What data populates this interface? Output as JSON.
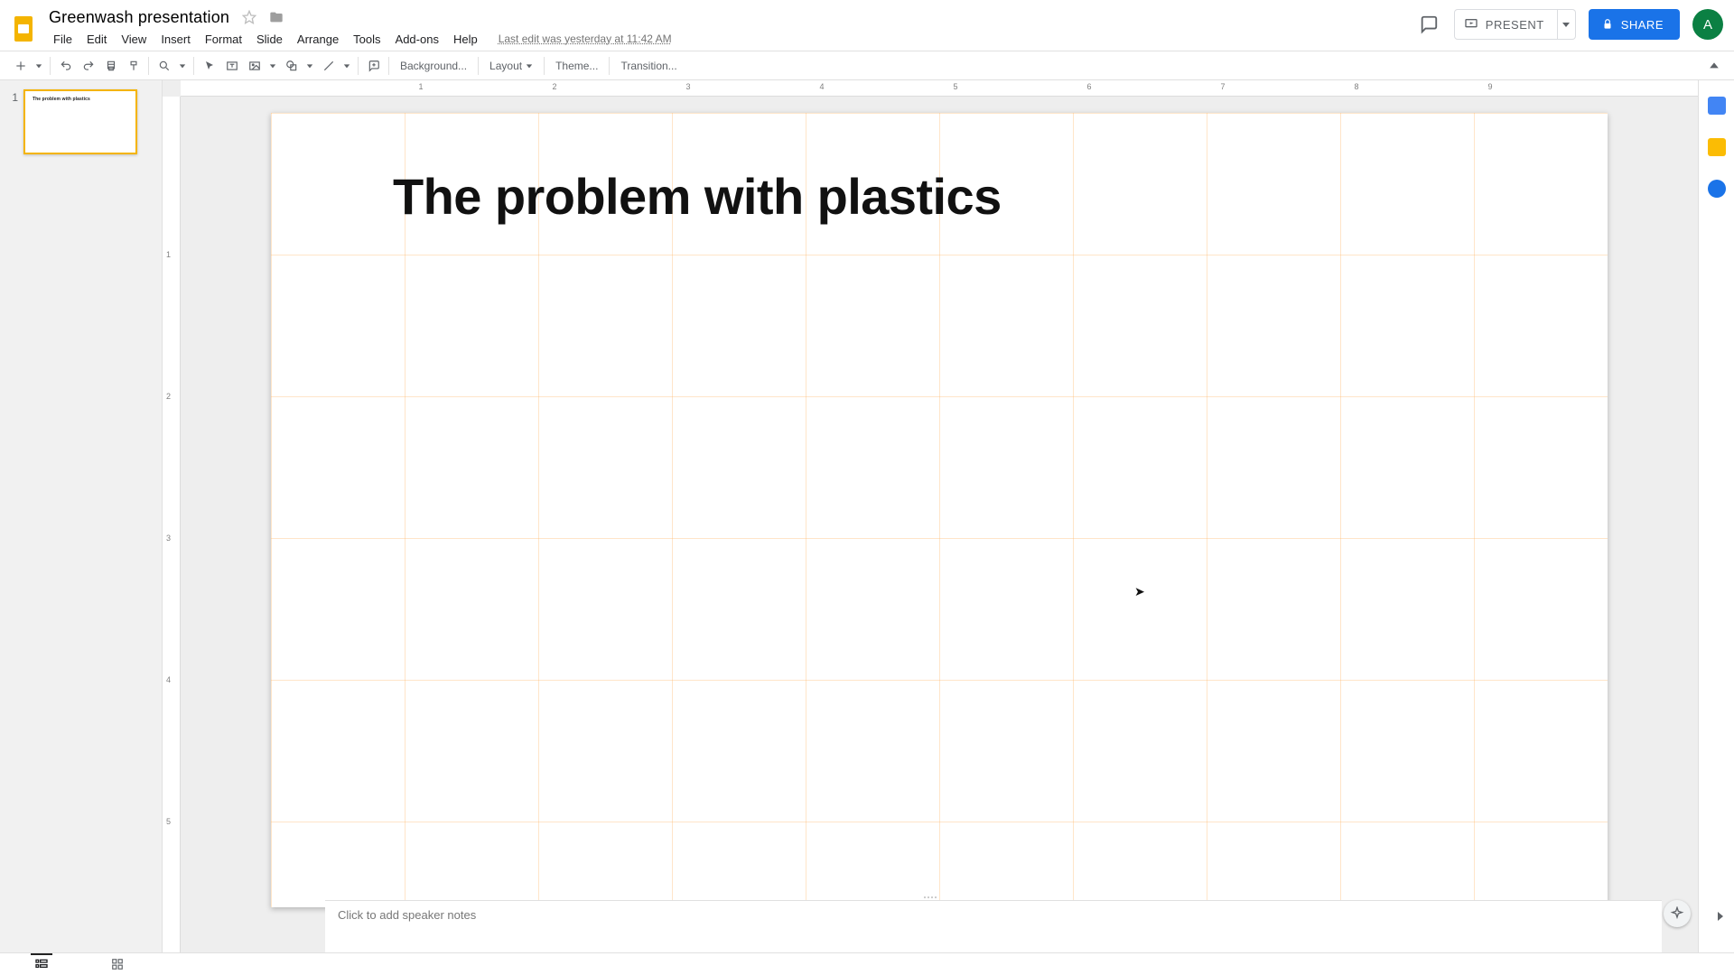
{
  "doc": {
    "title": "Greenwash presentation"
  },
  "menus": {
    "file": "File",
    "edit": "Edit",
    "view": "View",
    "insert": "Insert",
    "format": "Format",
    "slide": "Slide",
    "arrange": "Arrange",
    "tools": "Tools",
    "addons": "Add-ons",
    "help": "Help"
  },
  "last_edit": "Last edit was yesterday at 11:42 AM",
  "header": {
    "present": "PRESENT",
    "share": "SHARE",
    "avatar_letter": "A"
  },
  "toolbar": {
    "background": "Background...",
    "layout": "Layout",
    "theme": "Theme...",
    "transition": "Transition..."
  },
  "ruler": {
    "h_labels": [
      "1",
      "2",
      "3",
      "4",
      "5",
      "6",
      "7",
      "8",
      "9"
    ],
    "v_labels": [
      "1",
      "2",
      "3",
      "4",
      "5"
    ]
  },
  "filmstrip": {
    "slides": [
      {
        "num": "1",
        "title": "The problem with plastics"
      }
    ]
  },
  "slide": {
    "title": "The problem with plastics"
  },
  "speaker_notes_placeholder": "Click to add speaker notes",
  "colors": {
    "accent": "#f4b400",
    "share": "#1a73e8",
    "avatar": "#0b8043"
  }
}
